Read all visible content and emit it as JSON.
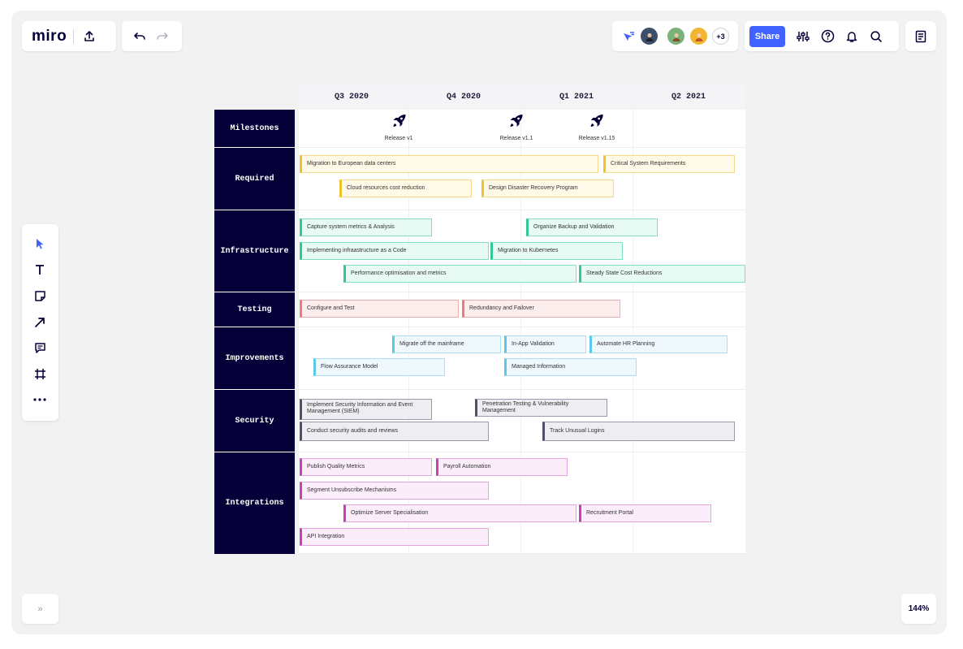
{
  "app": {
    "logo": "miro",
    "zoom": "144%"
  },
  "topbar": {
    "share_label": "Share",
    "collaborators_extra": "+3"
  },
  "left_toolbar": {
    "tools": [
      "select-icon",
      "text-icon",
      "sticky-note-icon",
      "arrow-icon",
      "comment-icon",
      "frame-icon",
      "more-icon"
    ]
  },
  "bottom": {
    "expand_label": "»"
  },
  "colors": {
    "accent": "#4262ff",
    "category_bg": "#050038",
    "canvas_bg": "#f2f2f2"
  },
  "board": {
    "quarters": [
      "Q3 2020",
      "Q4 2020",
      "Q1 2021",
      "Q2 2021"
    ],
    "milestones_label": "Milestones",
    "milestones": [
      "Release v1",
      "Release v1.1",
      "Release v1.15"
    ],
    "categories": [
      "Required",
      "Infrastructure",
      "Testing",
      "Improvements",
      "Security",
      "Integrations"
    ],
    "tasks": {
      "required": [
        "Migration to European data centers",
        "Critical System Requirements",
        "Cloud resources cost reduction",
        "Design Disaster Recovery Program"
      ],
      "infrastructure": [
        "Capture system metrics & Analysis",
        "Organize Backup and Validation",
        "Implementing infraastructure as a Code",
        "Migration to Kubernetes",
        "Performance optimisation and metrics",
        "Steady State Cost Reductions"
      ],
      "testing": [
        "Configure and Test",
        "Redundancy and Failover"
      ],
      "improvements": [
        "Migrate off the mainframe",
        "In-App Validation",
        "Automate HR Planning",
        "Flow Assurance Model",
        "Managed Information"
      ],
      "security": [
        "Implement Security Information and Event Management (SIEM)",
        "Penetration Testing & Vulnerability Management",
        "Conduct security audits and reviews",
        "Track Unusual Logins"
      ],
      "integrations": [
        "Publish Quality Metrics",
        "Payroll Automation",
        "Segment Unsubscribe Mechanisms",
        "Optimize Server Specialisation",
        "Recruitment Portal",
        "API Integration"
      ]
    }
  }
}
